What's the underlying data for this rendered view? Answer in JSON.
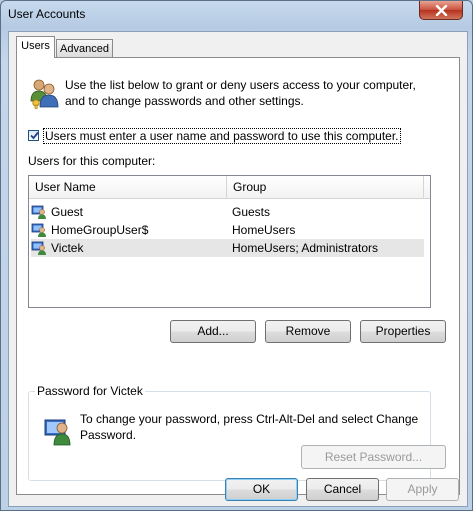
{
  "window": {
    "title": "User Accounts"
  },
  "tabs": [
    {
      "label": "Users",
      "active": true
    },
    {
      "label": "Advanced",
      "active": false
    }
  ],
  "intro_text": "Use the list below to grant or deny users access to your computer, and to change passwords and other settings.",
  "require_login": {
    "checked": true,
    "label": "Users must enter a user name and password to use this computer."
  },
  "users_list": {
    "label": "Users for this computer:",
    "columns": [
      "User Name",
      "Group"
    ],
    "rows": [
      {
        "name": "Guest",
        "group": "Guests",
        "selected": false
      },
      {
        "name": "HomeGroupUser$",
        "group": "HomeUsers",
        "selected": false
      },
      {
        "name": "Victek",
        "group": "HomeUsers; Administrators",
        "selected": true
      }
    ]
  },
  "list_buttons": {
    "add": "Add...",
    "remove": "Remove",
    "properties": "Properties"
  },
  "password_group": {
    "title": "Password for Victek",
    "text": "To change your password, press Ctrl-Alt-Del and select Change Password.",
    "reset_button": "Reset Password..."
  },
  "dialog_buttons": {
    "ok": "OK",
    "cancel": "Cancel",
    "apply": "Apply"
  },
  "icons": {
    "close": "close-icon",
    "users": "users-icon",
    "user": "user-icon",
    "password_user": "user-password-icon",
    "check": "checkmark-icon"
  },
  "colors": {
    "close_button": "#c8503b",
    "title_bar": "#b9cfe6",
    "selected_row": "#e6e6e6"
  }
}
